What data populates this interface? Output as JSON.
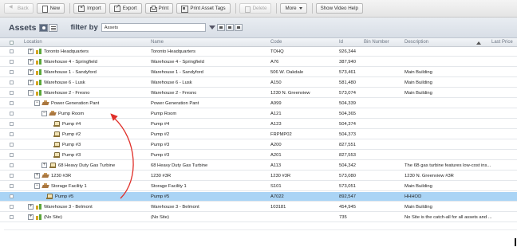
{
  "toolbar": {
    "back": "Back",
    "new": "New",
    "import": "Import",
    "export": "Export",
    "print": "Print",
    "print_tags": "Print Asset Tags",
    "delete": "Delete",
    "more": "More",
    "show_video_help": "Show Video Help"
  },
  "assets_bar": {
    "title": "Assets",
    "filter_by": "filter by",
    "filter_value": "Assets"
  },
  "columns": {
    "location": "Location",
    "name": "Name",
    "code": "Code",
    "id": "Id",
    "bin": "Bin Number",
    "description": "Description",
    "last_price": "Last Price"
  },
  "rows": [
    {
      "location": "Toronto Headquarters",
      "name": "Toronto Headquarters",
      "code": "TOHQ",
      "id": "926,344",
      "description": ""
    },
    {
      "location": "Warehouse 4 - Springfield",
      "name": "Warehouse 4 - Springfield",
      "code": "A76",
      "id": "387,940",
      "description": ""
    },
    {
      "location": "Warehouse 1 - Sandyford",
      "name": "Warehouse 1 - Sandyford",
      "code": "506 W. Oakdale",
      "id": "573,461",
      "description": "Main Building"
    },
    {
      "location": "Warehouse 6 - Lusk",
      "name": "Warehouse 6 - Lusk",
      "code": "A150",
      "id": "581,480",
      "description": "Main Building"
    },
    {
      "location": "Warehouse 2 - Fresno",
      "name": "Warehouse 2 - Fresno",
      "code": "1230 N. Greenview",
      "id": "573,074",
      "description": "Main Building"
    },
    {
      "location": "Power Generation Pant",
      "name": "Power Generation Pant",
      "code": "A999",
      "id": "504,339",
      "description": ""
    },
    {
      "location": "Pump Room",
      "name": "Pump Room",
      "code": "A121",
      "id": "504,365",
      "description": ""
    },
    {
      "location": "Pump #4",
      "name": "Pump #4",
      "code": "A123",
      "id": "504,374",
      "description": ""
    },
    {
      "location": "Pump #2",
      "name": "Pump #2",
      "code": "FRPMP02",
      "id": "504,373",
      "description": ""
    },
    {
      "location": "Pump #3",
      "name": "Pump #3",
      "code": "A200",
      "id": "827,551",
      "description": ""
    },
    {
      "location": "Pump #3",
      "name": "Pump #3",
      "code": "A201",
      "id": "827,553",
      "description": ""
    },
    {
      "location": "68 Heavy Duty Gas Turbine",
      "name": "68 Heavy Duty Gas Turbine",
      "code": "A113",
      "id": "504,342",
      "description": "The 6B gas turbine features low-cost ins..."
    },
    {
      "location": "1230 #3R",
      "name": "1230 #3R",
      "code": "1230 #3R",
      "id": "573,080",
      "description": "1230 N. Greenview #3R"
    },
    {
      "location": "Storage Facility 1",
      "name": "Storage Facility 1",
      "code": "S101",
      "id": "573,051",
      "description": "Main Building"
    },
    {
      "location": "Pump #5",
      "name": "Pump #5",
      "code": "A7022",
      "id": "892,547",
      "description": "HHHOD"
    },
    {
      "location": "Warehouse 3 - Belmont",
      "name": "Warehouse 3 - Belmont",
      "code": "103181",
      "id": "454,945",
      "description": "Main Building"
    },
    {
      "location": "(No Site)",
      "name": "(No Site)",
      "code": "",
      "id": "735",
      "description": "No Site is the catch-all for all assets and ..."
    }
  ],
  "colors": {
    "selected_row": "#aad4f5",
    "annotation_arrow": "#e0302a"
  },
  "icons": {
    "site": "site-icon",
    "building": "building-icon",
    "asset": "pump-asset-icon"
  }
}
